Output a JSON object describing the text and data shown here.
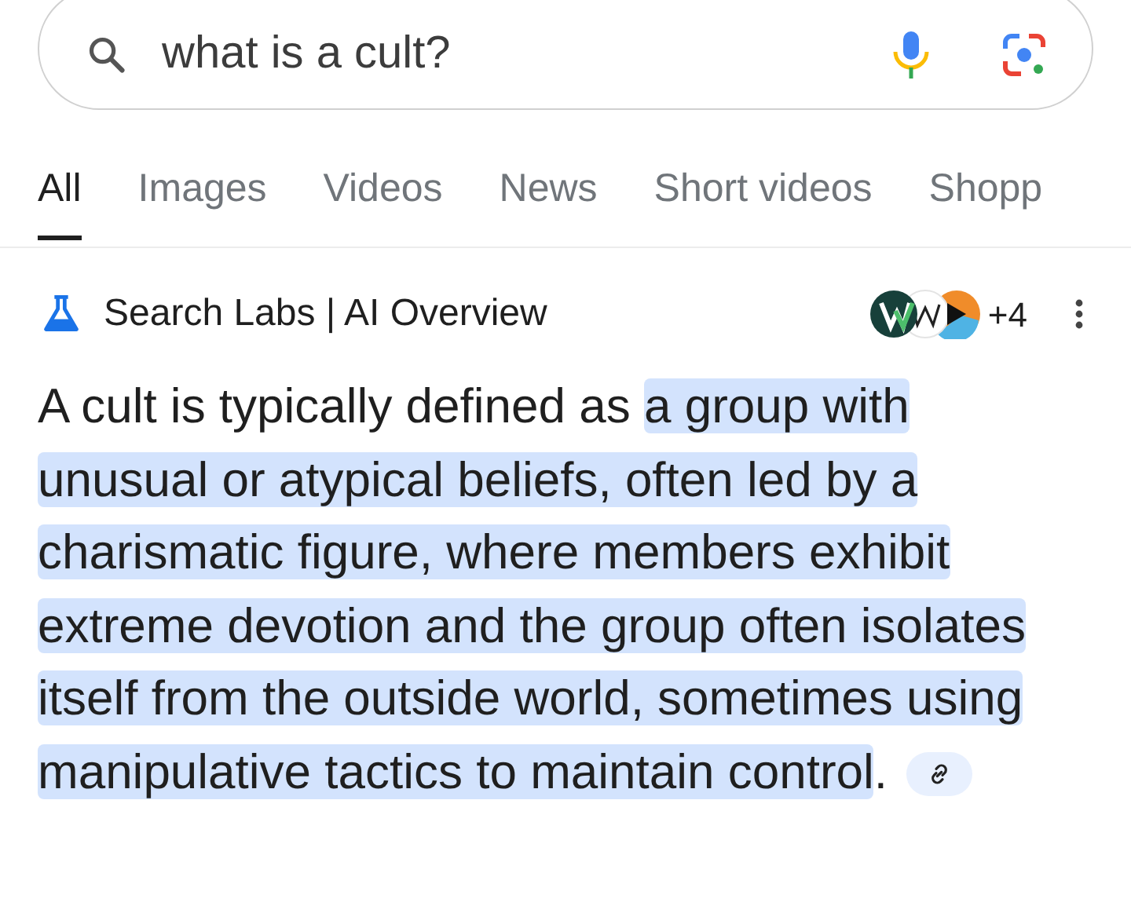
{
  "search": {
    "value": "what is a cult?"
  },
  "tabs": [
    {
      "label": "All",
      "selected": true
    },
    {
      "label": "Images",
      "selected": false
    },
    {
      "label": "Videos",
      "selected": false
    },
    {
      "label": "News",
      "selected": false
    },
    {
      "label": "Short videos",
      "selected": false
    },
    {
      "label": "Shopp",
      "selected": false
    }
  ],
  "overview": {
    "title": "Search Labs | AI Overview",
    "source_count": "+4",
    "answer": {
      "text": "A cult is typically defined as ",
      "highlight": "a group with unusual or atypical beliefs, often led by a charismatic figure, where members exhibit extreme devotion and the group often isolates itself from the outside world, sometimes using manipulative tactics to maintain control",
      "end": "."
    }
  }
}
